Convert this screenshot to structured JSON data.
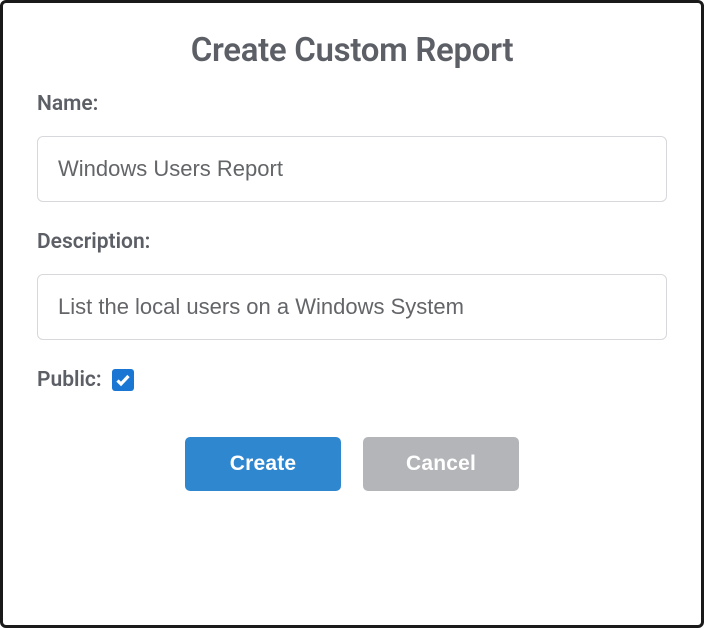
{
  "dialog": {
    "title": "Create Custom Report",
    "name_label": "Name:",
    "name_value": "Windows Users Report",
    "description_label": "Description:",
    "description_value": "List the local users on a Windows System",
    "public_label": "Public:",
    "public_checked": true,
    "create_label": "Create",
    "cancel_label": "Cancel"
  }
}
